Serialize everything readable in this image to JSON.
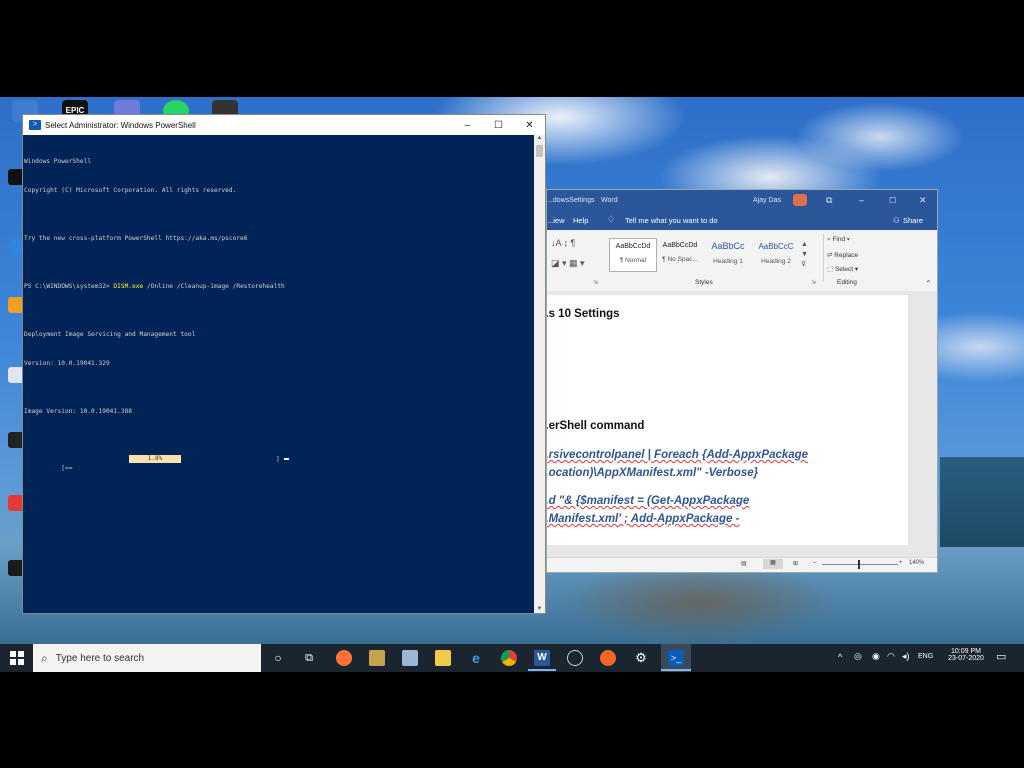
{
  "powershell": {
    "title": "Select Administrator: Windows PowerShell",
    "lines": [
      "Windows PowerShell",
      "Copyright (C) Microsoft Corporation. All rights reserved.",
      "",
      "Try the new cross-platform PowerShell https://aka.ms/pscore6",
      ""
    ],
    "prompt": "PS C:\\WINDOWS\\system32> ",
    "command": "DISM.exe",
    "command_args": " /Online /Cleanup-image /Restorehealth",
    "output": [
      "",
      "Deployment Image Servicing and Management tool",
      "Version: 10.0.19041.329",
      "",
      "Image Version: 10.0.19041.388",
      ""
    ],
    "progress_start": "[==",
    "progress_text": "1.8%",
    "progress_end": "]"
  },
  "word": {
    "title_doc": "...dowsSettings",
    "title_app": "Word",
    "user": "Ajay Das",
    "tabs": [
      "...iew",
      "Help"
    ],
    "tell_me": "Tell me what you want to do",
    "share": "Share",
    "styles": [
      {
        "preview": "AaBbCcDd",
        "name": "¶ Normal"
      },
      {
        "preview": "AaBbCcDd",
        "name": "¶ No Spac..."
      },
      {
        "preview": "AaBbCc",
        "name": "Heading 1"
      },
      {
        "preview": "AaBbCcC",
        "name": "Heading 2"
      }
    ],
    "styles_group": "Styles",
    "editing": {
      "find": "Find",
      "replace": "Replace",
      "select": "Select",
      "group": "Editing"
    },
    "doc_lines": [
      "...s 10 Settings",
      "...erShell command",
      "...rsivecontrolpanel | Foreach {Add-AppxPackage",
      "...ocation)\\AppXManifest.xml\" -Verbose}",
      "...d \"& {$manifest = (Get-AppxPackage",
      "...Manifest.xml' ; Add-AppxPackage -"
    ],
    "zoom": "140%"
  },
  "taskbar": {
    "search_placeholder": "Type here to search",
    "time": "10:09 PM",
    "date": "23-07-2020",
    "language": "ENG"
  },
  "desktop_top_icons": [
    "EPIC"
  ]
}
